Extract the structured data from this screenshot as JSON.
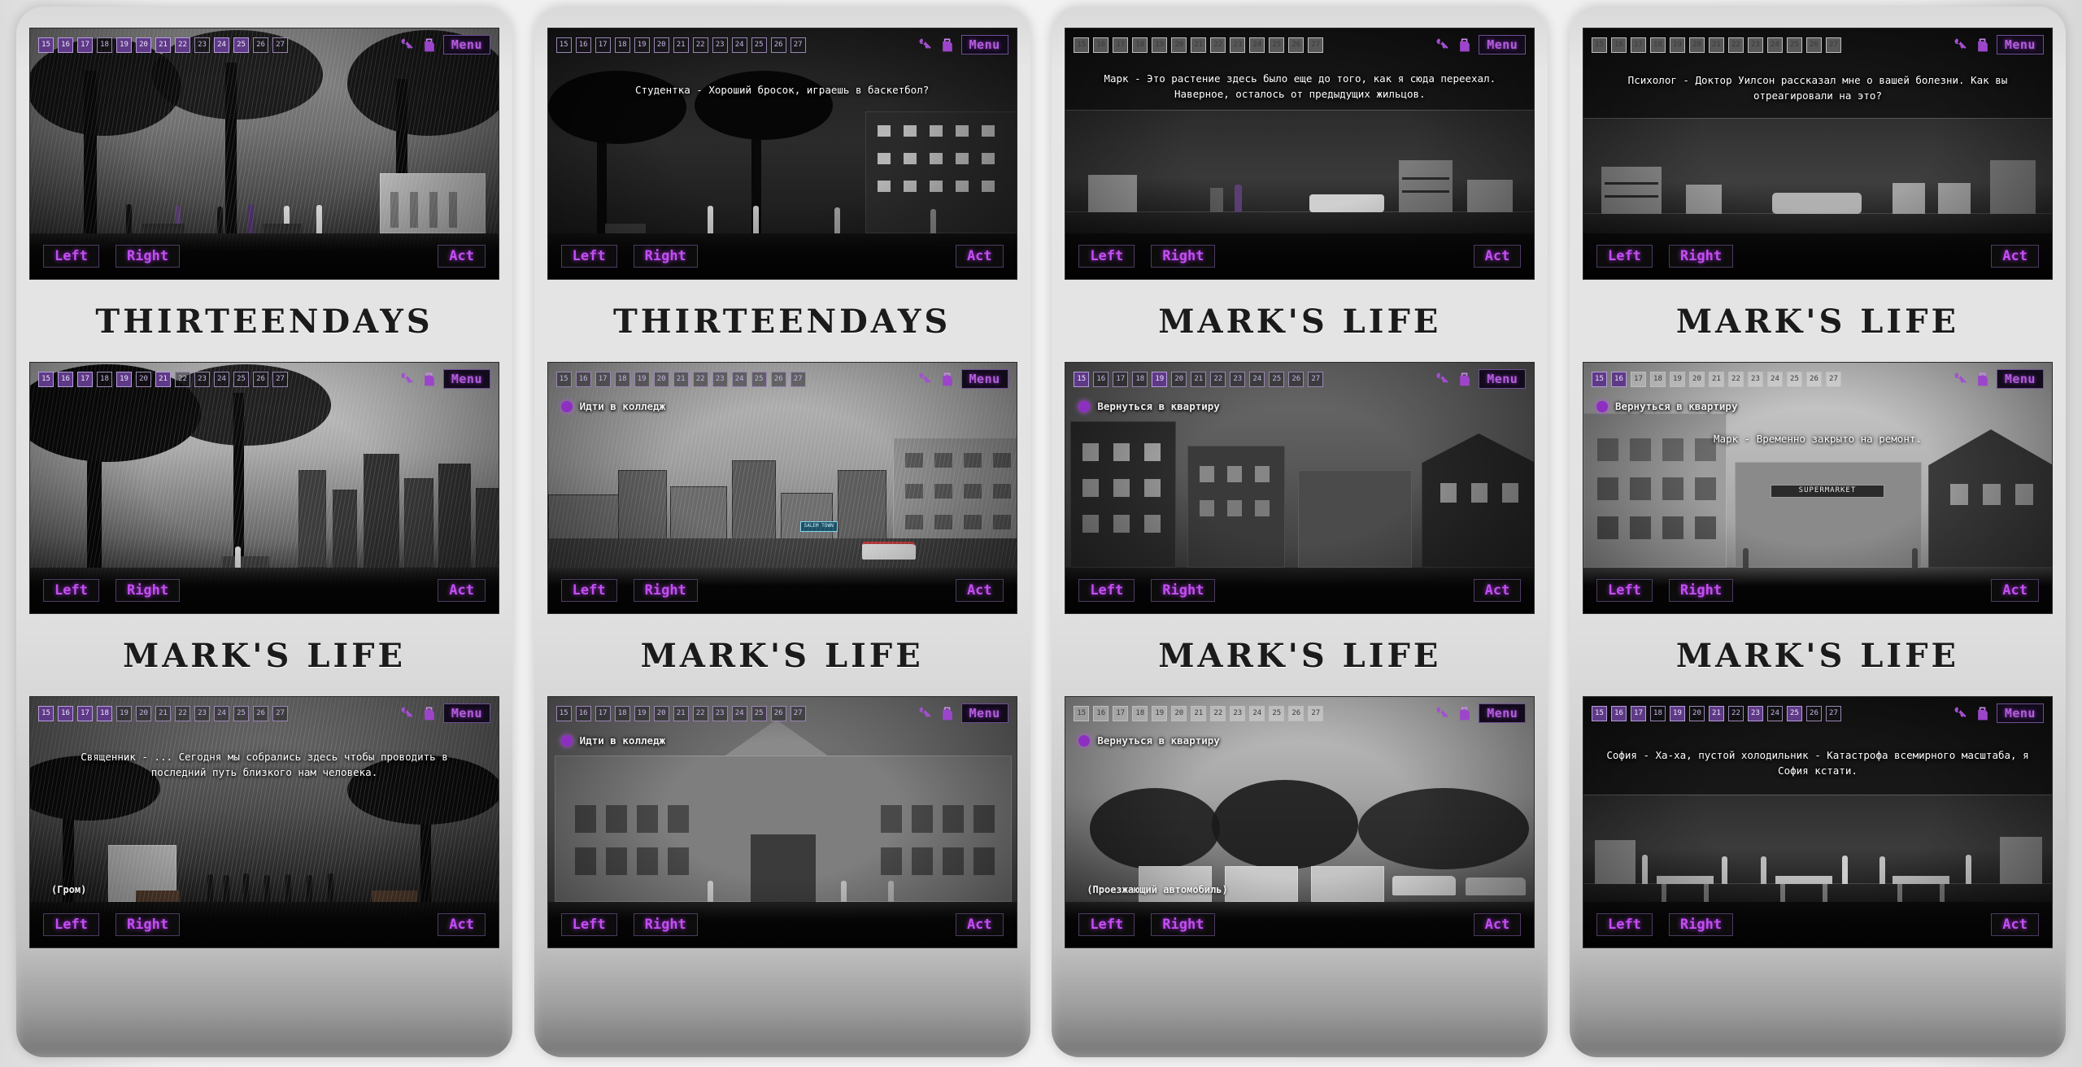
{
  "app": {
    "titles": [
      "THIRTEENDAYS",
      "MARK'S LIFE"
    ],
    "hud": {
      "menu_label": "Menu",
      "left_label": "Left",
      "right_label": "Right",
      "act_label": "Act",
      "icons": [
        "key-icon",
        "bag-icon"
      ],
      "accent_color": "#b05fd6",
      "day_numbers": [
        "15",
        "16",
        "17",
        "18",
        "19",
        "20",
        "21",
        "22",
        "23",
        "24",
        "25",
        "26",
        "27"
      ]
    }
  },
  "panels": [
    {
      "id": "panel-1",
      "title": "THIRTEENDAYS",
      "screens": [
        {
          "id": "p1-s1",
          "scene": "rainy-cemetery-trees",
          "days_active": [
            0,
            1,
            2,
            6,
            7,
            9,
            10
          ],
          "dialogue": "",
          "sfx": "",
          "hotspot": ""
        },
        {
          "id": "p1-s2",
          "scene": "park-bench-skyline",
          "days_active": [
            0,
            1,
            2,
            4,
            6
          ],
          "dialogue": "",
          "sfx": "",
          "hotspot": ""
        },
        {
          "id": "p1-s3",
          "scene": "funeral-gathering",
          "days_active": [
            0,
            1,
            2,
            3
          ],
          "dialogue": "Священник -  ... Сегодня мы собрались здесь чтобы проводить в последний путь близкого нам человека.",
          "sfx": "(Гром)",
          "hotspot": ""
        }
      ]
    },
    {
      "id": "panel-2",
      "title": "THIRTEENDAYS",
      "screens": [
        {
          "id": "p2-s1",
          "scene": "night-street-trees",
          "days_active": [],
          "dialogue": "Студентка - Хороший бросок, играешь в баскетбол?",
          "sfx": "",
          "hotspot": ""
        },
        {
          "id": "p2-s2",
          "scene": "town-road-ambulance",
          "days_active": [],
          "dialogue": "",
          "sfx": "",
          "hotspot": "Идти в колледж",
          "sign_text": "SALEM TOWN"
        },
        {
          "id": "p2-s3",
          "scene": "college-building",
          "days_active": [],
          "dialogue": "",
          "sfx": "",
          "hotspot": "Идти в колледж"
        }
      ]
    },
    {
      "id": "panel-3",
      "title": "MARK'S LIFE",
      "screens": [
        {
          "id": "p3-s1",
          "scene": "apartment-interior",
          "days_active": [],
          "dialogue": "Марк - Это растение здесь было еще до того, как я сюда переехал. Наверное, осталось от предыдущих жильцов.",
          "sfx": "",
          "hotspot": ""
        },
        {
          "id": "p3-s2",
          "scene": "city-street-brick-houses",
          "days_active": [
            0,
            4
          ],
          "dialogue": "",
          "sfx": "",
          "hotspot": "Вернуться в квартиру"
        },
        {
          "id": "p3-s3",
          "scene": "parking-lot-trees",
          "days_active": [
            0
          ],
          "dialogue": "",
          "sfx": "(Проезжающий автомобиль)",
          "hotspot": "Вернуться в квартиру"
        }
      ]
    },
    {
      "id": "panel-4",
      "title": "MARK'S LIFE",
      "screens": [
        {
          "id": "p4-s1",
          "scene": "psychologist-office",
          "days_active": [
            0,
            1
          ],
          "dialogue": "Психолог - Доктор Уилсон рассказал мне о вашей болезни. Как вы отреагировали на это?",
          "sfx": "",
          "hotspot": ""
        },
        {
          "id": "p4-s2",
          "scene": "supermarket-street",
          "days_active": [
            0,
            1
          ],
          "dialogue": "Марк -  Временно закрыто на ремонт.",
          "sfx": "",
          "hotspot": "Вернуться в квартиру",
          "sign_text": "SUPERMARKET"
        },
        {
          "id": "p4-s3",
          "scene": "cafe-interior",
          "days_active": [
            0,
            1,
            2,
            4,
            6,
            8,
            10
          ],
          "dialogue": "София - Ха-ха, пустой холодильник - Катастрофа всемирного масштаба, я София кстати.",
          "sfx": "",
          "hotspot": ""
        }
      ]
    }
  ]
}
